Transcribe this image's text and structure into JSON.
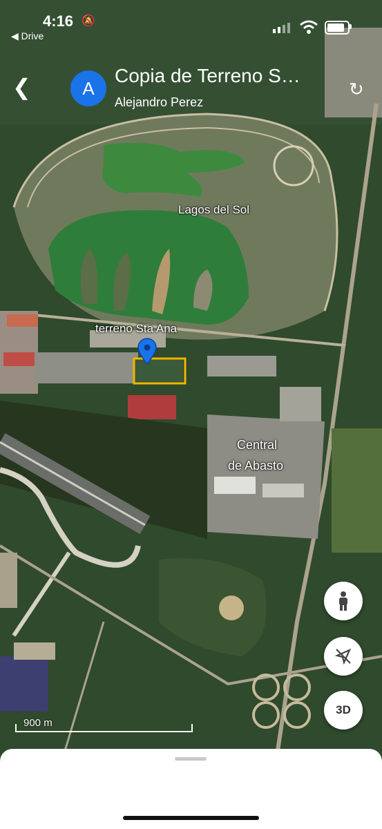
{
  "status_bar": {
    "time": "4:16",
    "back_app": "◀ Drive"
  },
  "header": {
    "avatar_letter": "A",
    "title": "Copia de Terreno S…",
    "subtitle": "Alejandro Perez",
    "back_icon": "chevron-left-icon",
    "refresh_icon": "refresh-icon"
  },
  "map": {
    "labels": {
      "lagos": "Lagos del Sol",
      "terreno": "terreno Sta Ana",
      "central_line1": "Central",
      "central_line2": "de Abasto"
    },
    "marker_color": "#1a73e8",
    "parcel_outline_color": "#f2b400",
    "scale_label": "900 m"
  },
  "controls": {
    "street_view_icon": "pegman-icon",
    "location_icon": "location-off-icon",
    "three_d_label": "3D"
  }
}
